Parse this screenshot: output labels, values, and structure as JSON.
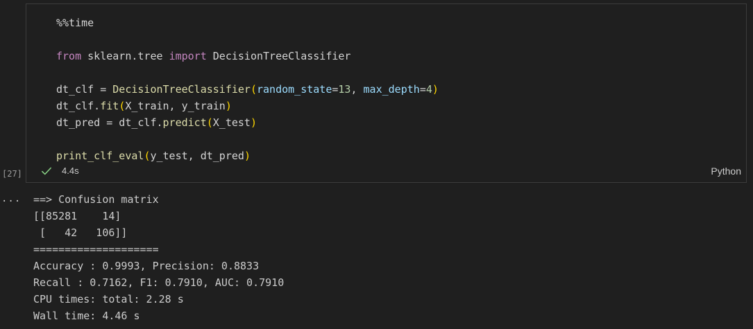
{
  "cell": {
    "execution_count": "[27]",
    "status_icon": "check-icon",
    "elapsed": "4.4s",
    "language": "Python",
    "code": {
      "magic": "%%time",
      "import_from": "from",
      "import_module": " sklearn.tree ",
      "import_kw": "import",
      "import_name": " DecisionTreeClassifier",
      "l3_var": "dt_clf = ",
      "l3_cls": "DecisionTreeClassifier",
      "l3_open": "(",
      "l3_p1": "random_state",
      "l3_eq1": "=",
      "l3_v1": "13",
      "l3_comma": ", ",
      "l3_p2": "max_depth",
      "l3_eq2": "=",
      "l3_v2": "4",
      "l3_close": ")",
      "l4_pre": "dt_clf.",
      "l4_fn": "fit",
      "l4_open": "(",
      "l4_args": "X_train, y_train",
      "l4_close": ")",
      "l5_pre": "dt_pred = dt_clf.",
      "l5_fn": "predict",
      "l5_open": "(",
      "l5_args": "X_test",
      "l5_close": ")",
      "l6_fn": "print_clf_eval",
      "l6_open": "(",
      "l6_args": "y_test, dt_pred",
      "l6_close": ")"
    }
  },
  "output": {
    "menu_label": "...",
    "lines": [
      "==> Confusion matrix",
      "[[85281    14]",
      " [   42   106]]",
      "====================",
      "Accuracy : 0.9993, Precision: 0.8833",
      "Recall : 0.7162, F1: 0.7910, AUC: 0.7910",
      "CPU times: total: 2.28 s",
      "Wall time: 4.46 s"
    ]
  },
  "colors": {
    "background": "#1f1f1f",
    "keyword": "#c586c0",
    "function": "#dcdcaa",
    "parameter": "#9cdcfe",
    "number": "#b5cea8",
    "bracket": "#ffd700",
    "success": "#89d185"
  }
}
